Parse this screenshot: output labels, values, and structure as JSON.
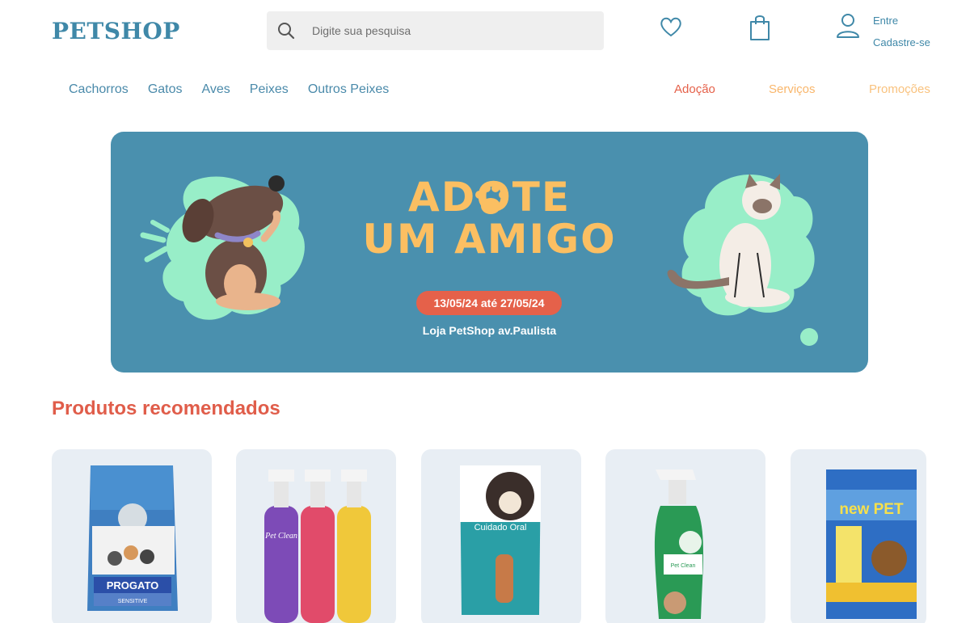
{
  "header": {
    "logo": "PETSHOP",
    "search_placeholder": "Digite sua pesquisa",
    "account": {
      "signin": "Entre",
      "signup": "Cadastre-se"
    },
    "icons": [
      "search-icon",
      "heart-icon",
      "bag-icon",
      "user-icon"
    ]
  },
  "nav": {
    "categories": [
      {
        "label": "Cachorros"
      },
      {
        "label": "Gatos"
      },
      {
        "label": "Aves"
      },
      {
        "label": "Peixes"
      },
      {
        "label": "Outros Peixes"
      }
    ],
    "highlights": [
      {
        "label": "Adoção",
        "color": "#e5614a"
      },
      {
        "label": "Serviços",
        "color": "#f9b66b"
      },
      {
        "label": "Promoções",
        "color": "#f9c27e"
      }
    ]
  },
  "banner": {
    "title_line1": "ADOTE",
    "title_line2": "UM AMIGO",
    "date_range": "13/05/24 até 27/05/24",
    "location": "Loja PetShop av.Paulista"
  },
  "recommended": {
    "title": "Produtos recomendados",
    "products": [
      {
        "brand": "PROGATO",
        "tag": "SENSITIVE"
      },
      {
        "brand": "Pet Clean"
      },
      {
        "brand": "Cuidado Oral"
      },
      {
        "brand": "Pet Clean"
      },
      {
        "brand": "new PET"
      }
    ]
  },
  "colors": {
    "brand": "#3f88a8",
    "accent_red": "#e05d4a",
    "banner_bg": "#4a90ae",
    "banner_text": "#fbbf62",
    "blob": "#98eec8"
  }
}
